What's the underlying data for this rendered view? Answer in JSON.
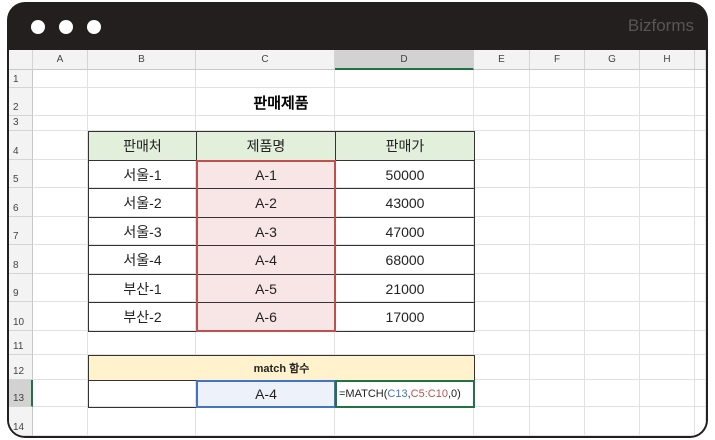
{
  "window": {
    "brand": "Bizforms"
  },
  "columns": [
    "A",
    "B",
    "C",
    "D",
    "E",
    "F",
    "G",
    "H"
  ],
  "selected_column": "D",
  "rows": [
    "1",
    "2",
    "3",
    "4",
    "5",
    "6",
    "7",
    "8",
    "9",
    "10",
    "11",
    "12",
    "13",
    "14"
  ],
  "selected_row": "13",
  "title": "판매제품",
  "table": {
    "headers": [
      "판매처",
      "제품명",
      "판매가"
    ],
    "rows": [
      [
        "서울-1",
        "A-1",
        "50000"
      ],
      [
        "서울-2",
        "A-2",
        "43000"
      ],
      [
        "서울-3",
        "A-3",
        "47000"
      ],
      [
        "서울-4",
        "A-4",
        "68000"
      ],
      [
        "부산-1",
        "A-5",
        "21000"
      ],
      [
        "부산-2",
        "A-6",
        "17000"
      ]
    ]
  },
  "match": {
    "label": "match 함수",
    "b13": "",
    "lookup": "A-4",
    "formula_prefix": "=MATCH(",
    "ref1": "C13",
    "sep": ",",
    "ref2": "C5:C10",
    "suffix": ",0)"
  },
  "colors": {
    "header_green": "#e2efda",
    "match_yellow": "#fff2cc",
    "ref_blue": "#4472c4",
    "ref_red": "#c0504d",
    "active_green": "#217346"
  }
}
